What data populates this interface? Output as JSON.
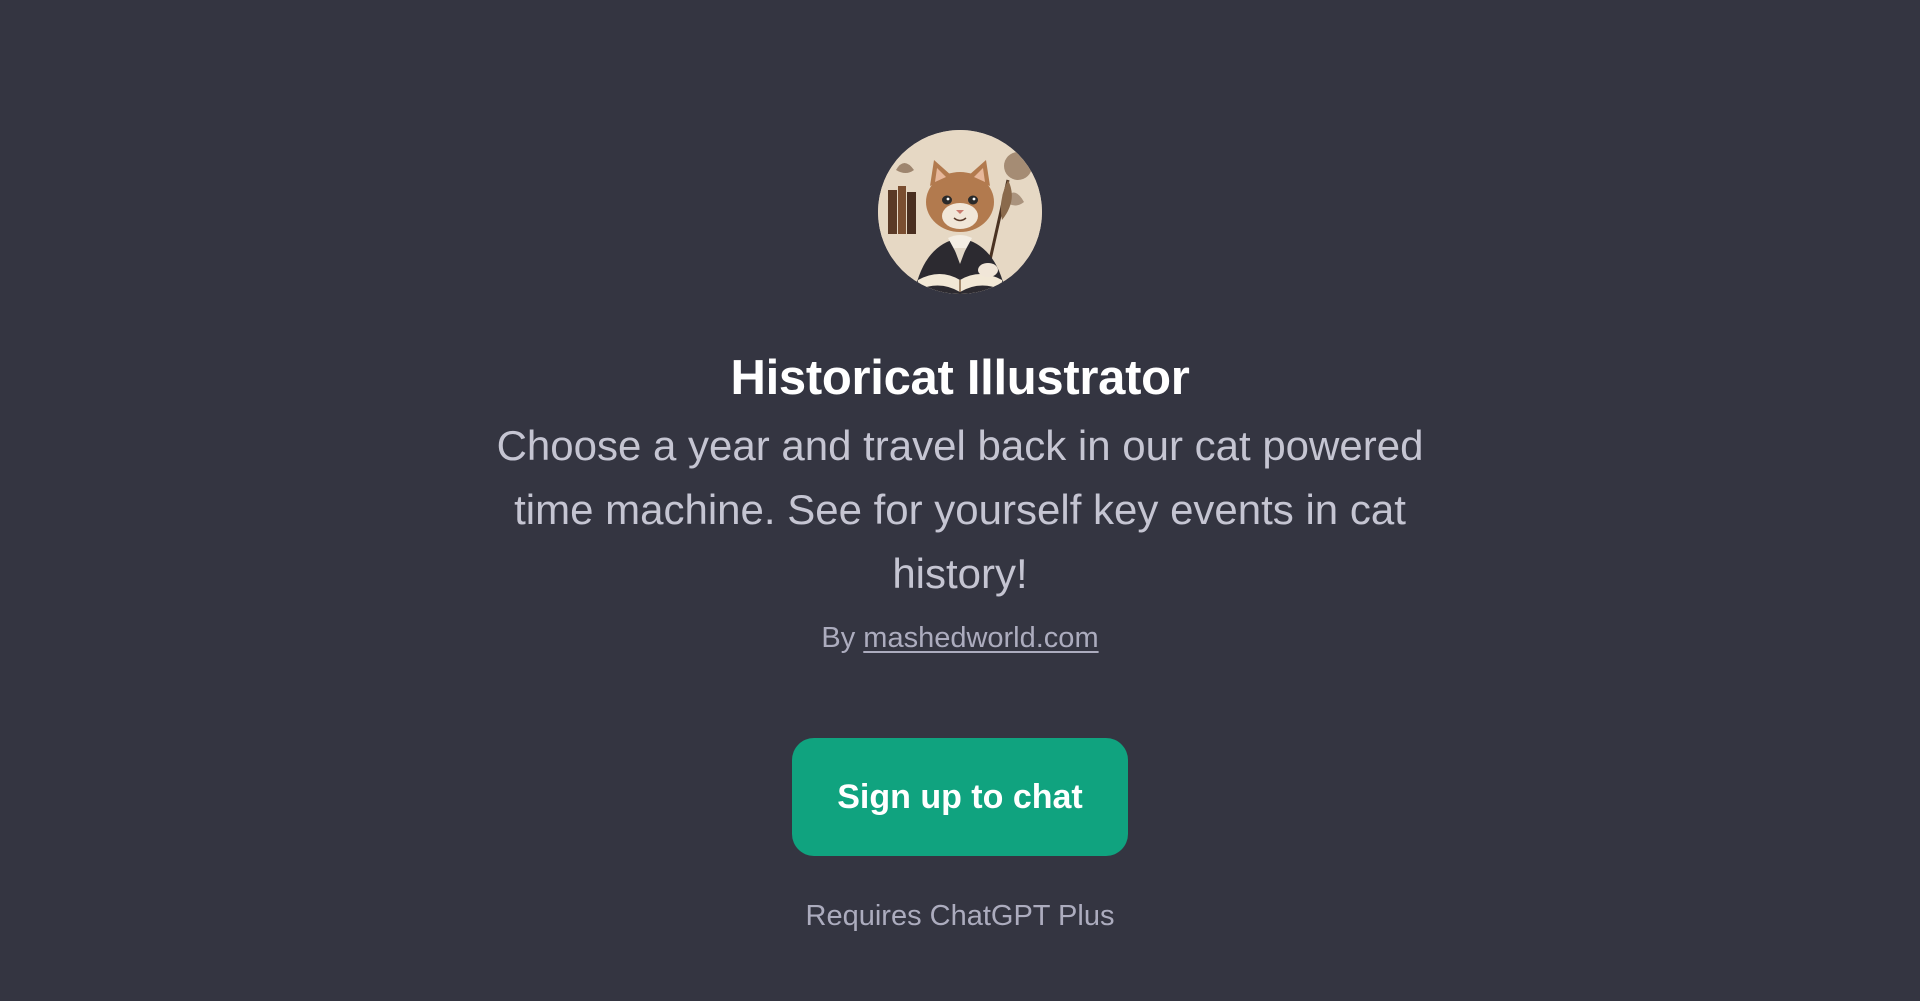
{
  "gpt": {
    "avatar_icon": "cat-scholar-avatar-icon",
    "title": "Historicat Illustrator",
    "description": "Choose a year and travel back in our cat powered time machine. See for yourself key events in cat history!",
    "by_prefix": "By",
    "author": "mashedworld.com"
  },
  "cta": {
    "label": "Sign up to chat",
    "color": "#10a37f"
  },
  "footer": {
    "requirement": "Requires ChatGPT Plus"
  },
  "theme": {
    "background": "#343541",
    "title_color": "#ffffff",
    "text_color": "#c5c5d2",
    "muted_color": "#acacbe"
  }
}
